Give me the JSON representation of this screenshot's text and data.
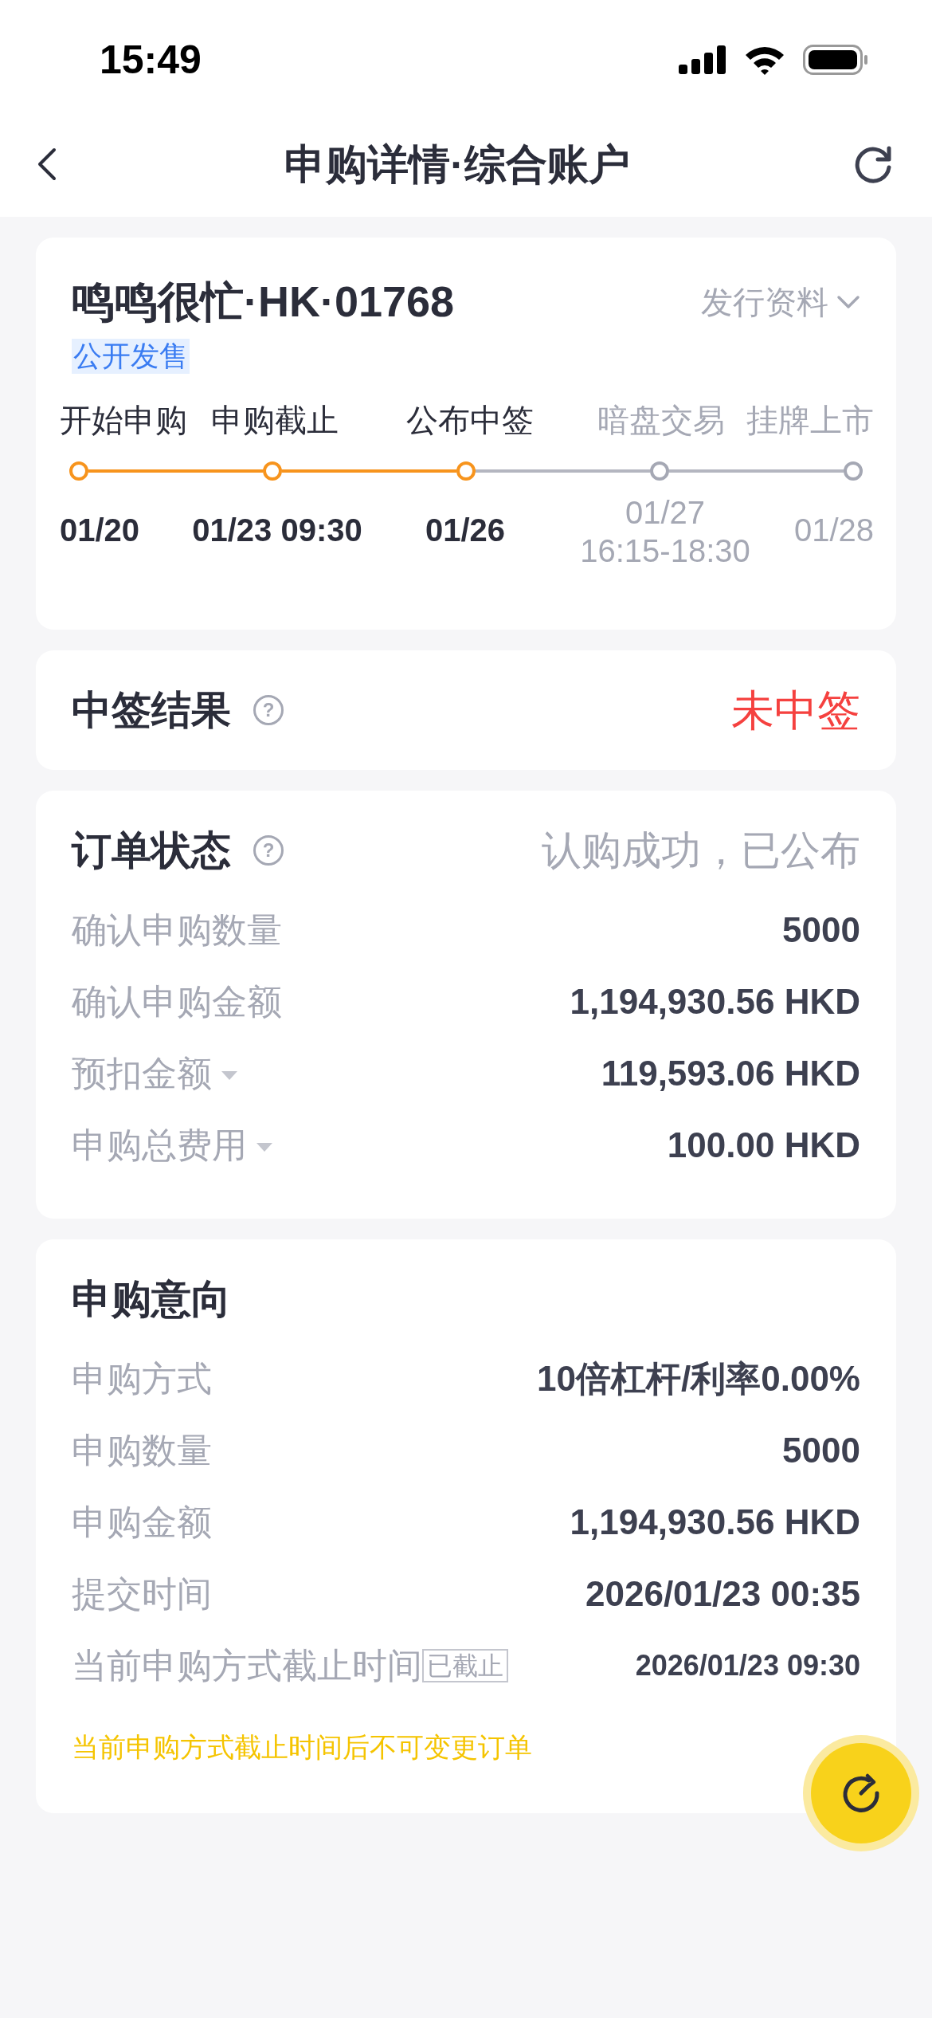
{
  "status_bar": {
    "time": "15:49"
  },
  "nav": {
    "title": "申购详情·综合账户"
  },
  "stock": {
    "name": "鸣鸣很忙·HK·01768",
    "tag": "公开发售",
    "info_link": "发行资料",
    "timeline": [
      {
        "label": "开始申购",
        "date": "01/20",
        "done": true
      },
      {
        "label": "申购截止",
        "date": "01/23 09:30",
        "done": true
      },
      {
        "label": "公布中签",
        "date": "01/26",
        "done": true
      },
      {
        "label": "暗盘交易",
        "date": "01/27",
        "time": "16:15-18:30",
        "done": false
      },
      {
        "label": "挂牌上市",
        "date": "01/28",
        "done": false
      }
    ]
  },
  "result": {
    "title": "中签结果",
    "help": "?",
    "value": "未中签"
  },
  "order": {
    "title": "订单状态",
    "help": "?",
    "status": "认购成功，已公布",
    "rows": [
      {
        "label": "确认申购数量",
        "value": "5000",
        "dropdown": false
      },
      {
        "label": "确认申购金额",
        "value": "1,194,930.56 HKD",
        "dropdown": false
      },
      {
        "label": "预扣金额",
        "value": "119,593.06 HKD",
        "dropdown": true
      },
      {
        "label": "申购总费用",
        "value": "100.00 HKD",
        "dropdown": true
      }
    ]
  },
  "intent": {
    "title": "申购意向",
    "rows": [
      {
        "label": "申购方式",
        "value": "10倍杠杆/利率0.00%"
      },
      {
        "label": "申购数量",
        "value": "5000"
      },
      {
        "label": "申购金额",
        "value": "1,194,930.56 HKD"
      },
      {
        "label": "提交时间",
        "value": "2026/01/23 00:35"
      },
      {
        "label": "当前申购方式截止时间",
        "badge": "已截止",
        "value": "2026/01/23 09:30"
      }
    ],
    "note": "当前申购方式截止时间后不可变更订单"
  }
}
